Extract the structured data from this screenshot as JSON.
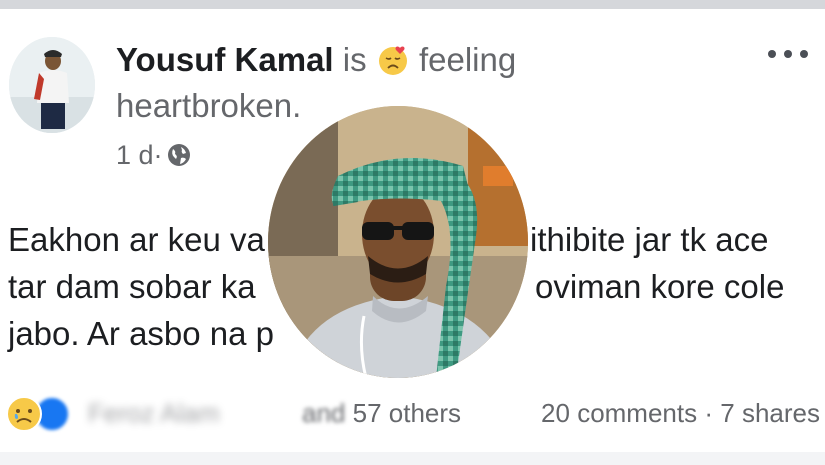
{
  "post": {
    "author": "Yousuf Kamal",
    "is_word": "is",
    "feeling_word": "feeling",
    "feeling": "heartbroken.",
    "feeling_icon": "sad-face-with-heart-emoji",
    "time": "1 d",
    "separator": "·",
    "privacy_icon": "globe-icon",
    "text_visible_fragments": [
      "Eakhon ar keu va",
      "ithibite jar tk ace",
      "tar dam sobar ka",
      "oviman kore cole",
      "jabo. Ar asbo na p"
    ]
  },
  "reactions": {
    "icons": [
      "sad-reaction-icon",
      "like-reaction-icon"
    ],
    "blurred_name": "Feroz Alam",
    "and_word": "and",
    "count_text": "57 others"
  },
  "stats": {
    "comments": "20 comments",
    "dot": "·",
    "shares": "7 shares"
  },
  "colors": {
    "primary_text": "#1c1e21",
    "secondary_text": "#65676b",
    "like_blue": "#1877f2",
    "reaction_yellow": "#f7c948"
  }
}
